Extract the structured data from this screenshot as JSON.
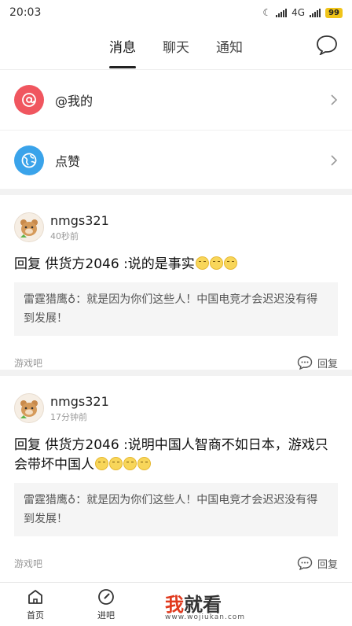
{
  "statusbar": {
    "time": "20:03",
    "network": "4G",
    "battery": "99"
  },
  "tabs": [
    {
      "label": "消息",
      "active": true
    },
    {
      "label": "聊天",
      "active": false
    },
    {
      "label": "通知",
      "active": false
    }
  ],
  "toplist": [
    {
      "label": "@我的",
      "icon": "at-icon",
      "color": "#f0565f"
    },
    {
      "label": "点赞",
      "icon": "globe-icon",
      "color": "#3aa3ea"
    }
  ],
  "cards": [
    {
      "username": "nmgs321",
      "time": "40秒前",
      "reply": "回复 供货方2046 :说的是事实",
      "emoji_count": 3,
      "quote": "雷霆猎鹰♁：就是因为你们这些人！中国电竞才会迟迟没有得到发展！",
      "forum": "游戏吧",
      "reply_label": "回复"
    },
    {
      "username": "nmgs321",
      "time": "17分钟前",
      "reply": "回复 供货方2046 :说明中国人智商不如日本，游戏只会带坏中国人",
      "emoji_count": 4,
      "quote": "雷霆猎鹰♁：就是因为你们这些人！中国电竞才会迟迟没有得到发展！",
      "forum": "游戏吧",
      "reply_label": "回复"
    }
  ],
  "bottomnav": [
    {
      "label": "首页",
      "icon": "home-icon"
    },
    {
      "label": "进吧",
      "icon": "compass-icon"
    }
  ],
  "watermark": {
    "part1": "我",
    "part2": "就看",
    "url": "www.wojiukan.com"
  }
}
